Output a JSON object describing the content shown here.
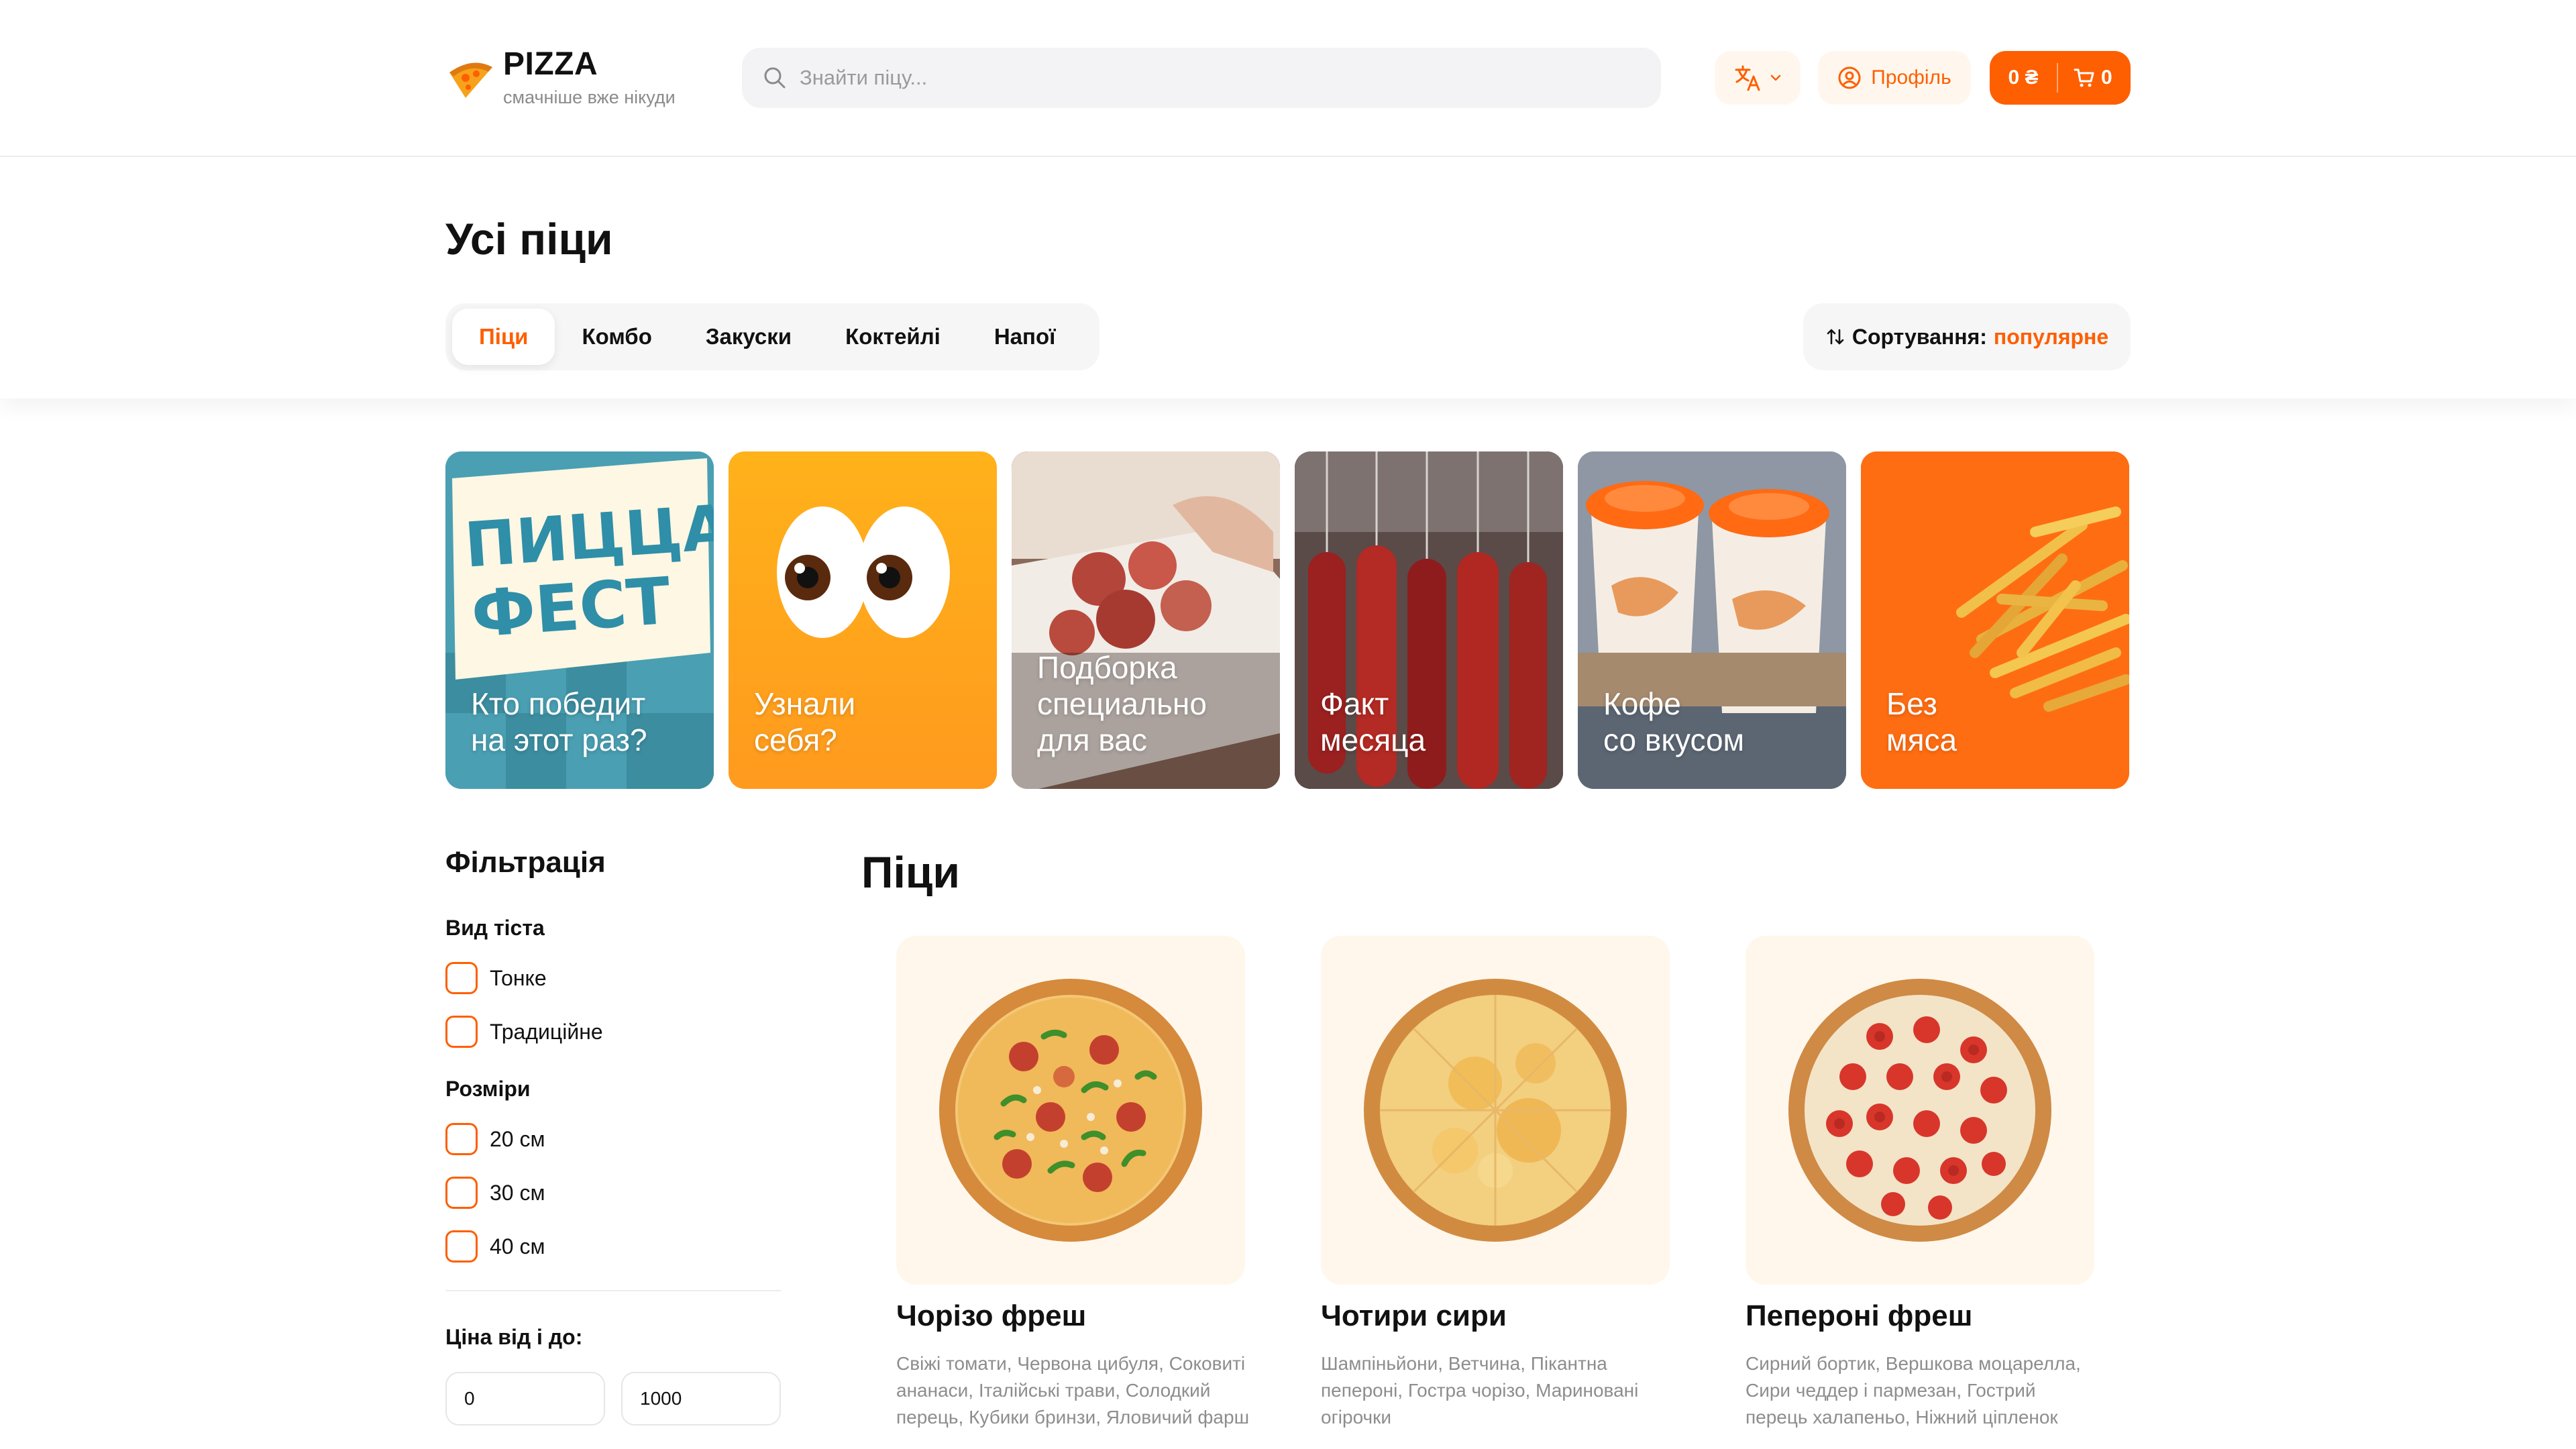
{
  "brand": {
    "name": "PIZZA",
    "tagline": "смачніше вже нікуди"
  },
  "search": {
    "placeholder": "Знайти піцу..."
  },
  "header": {
    "profile_label": "Профіль",
    "cart_sum": "0 ₴",
    "cart_count": "0"
  },
  "page_title": "Усі піци",
  "tabs": [
    "Піци",
    "Комбо",
    "Закуски",
    "Коктейлі",
    "Напої"
  ],
  "active_tab": "Піци",
  "sort": {
    "label": "Сортування:",
    "value": "популярне"
  },
  "stories": [
    {
      "text": "Кто победит\nна этот раз?",
      "headline": "ПИЦЦА ФЕСТ"
    },
    {
      "text": "Узнали\nсебя?"
    },
    {
      "text": "Подборка\nспециально\nдля вас"
    },
    {
      "text": "Факт\nмесяца"
    },
    {
      "text": "Кофе\nсо вкусом"
    },
    {
      "text": "Без\nмяса"
    }
  ],
  "filters": {
    "title": "Фільтрація",
    "dough_label": "Вид тіста",
    "dough_options": [
      "Тонке",
      "Традиційне"
    ],
    "size_label": "Розміри",
    "size_options": [
      "20 см",
      "30 см",
      "40 см"
    ],
    "price_label": "Ціна від і до:",
    "price_from": "0",
    "price_to": "1000"
  },
  "section_title": "Піци",
  "products": [
    {
      "name": "Чорізо фреш",
      "description": "Свіжі томати, Червона цибуля, Соковиті ананаси, Італійські трави, Солодкий перець, Кубики бринзи, Яловичий фарш"
    },
    {
      "name": "Чотири сири",
      "description": "Шампіньйони, Ветчина, Пікантна пепероні, Гостра чорізо, Мариновані огірочки"
    },
    {
      "name": "Пепероні фреш",
      "description": "Сирний бортик, Вершкова моцарелла, Сири чеддер і пармезан, Гострий перець халапеньо, Ніжний цiпленок"
    }
  ],
  "colors": {
    "accent": "#fe5f00",
    "accent_soft": "#fff7ee",
    "text": "#111111",
    "muted": "#8d8d8d"
  }
}
